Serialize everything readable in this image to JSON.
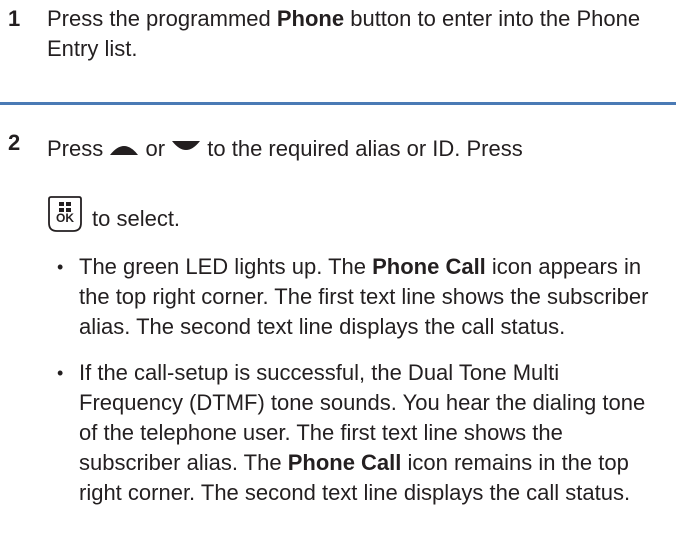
{
  "step1": {
    "number": "1",
    "text_before": "Press the programmed ",
    "bold": "Phone",
    "text_after": " button to enter into the Phone Entry list."
  },
  "step2": {
    "number": "2",
    "line1_a": "Press ",
    "line1_or": " or ",
    "line1_b": " to the required alias or ID. Press",
    "up_icon": "up-arrow-icon",
    "down_icon": "down-arrow-icon",
    "ok_icon": "menu-ok-key-icon",
    "ok_label": "OK",
    "select_text": "to select.",
    "bullets": [
      {
        "pre": "The green LED lights up. The ",
        "bold": "Phone Call",
        "post": " icon appears in the top right corner. The first text line shows the subscriber alias. The second text line displays the call status."
      },
      {
        "pre": "If the call-setup is successful, the Dual Tone Multi Frequency (DTMF) tone sounds. You hear the dialing tone of the telephone user. The first text line shows the subscriber alias. The ",
        "bold": "Phone Call",
        "post": " icon remains in the top right corner. The second text line displays the call status."
      }
    ]
  },
  "colors": {
    "divider": "#4a7ab5",
    "text": "#231f20"
  }
}
